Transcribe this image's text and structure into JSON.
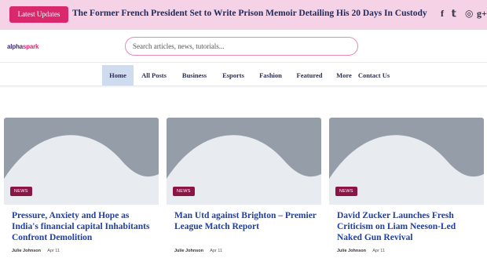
{
  "topbar": {
    "latest_label": "Latest Updates",
    "headline": "The Former French President Set to Write Prison Memoir Detailing His 20 Days In Custody",
    "social": [
      {
        "icon": "facebook-icon",
        "glyph": "f"
      },
      {
        "icon": "twitter-icon",
        "glyph": "𝕥"
      },
      {
        "icon": "instagram-icon",
        "glyph": "◎"
      },
      {
        "icon": "google-plus-icon",
        "glyph": "g+"
      }
    ]
  },
  "header": {
    "logo_part1": "alpha",
    "logo_part2": "spark",
    "search_placeholder": "Search articles, news, tutorials..."
  },
  "nav": {
    "items": [
      "Home",
      "All Posts",
      "Business",
      "Esports",
      "Fashion",
      "Featured",
      "More",
      "Contact Us"
    ],
    "active": "Home"
  },
  "cards": [
    {
      "badge": "NEWS",
      "title": "Pressure, Anxiety and Hope as India's financial capital Inhabitants Confront Demolition",
      "author": "Julie Johnson",
      "date": "Apr 11"
    },
    {
      "badge": "NEWS",
      "title": "Man Utd against Brighton – Premier League Match Report",
      "author": "Julie Johnson",
      "date": "Apr 11"
    },
    {
      "badge": "NEWS",
      "title": "David Zucker Launches Fresh Criticism on Liam Neeson-Led Naked Gun Revival",
      "author": "Julie Johnson",
      "date": "Apr 11"
    }
  ],
  "colors": {
    "topbar_bg": "#f5d2e5",
    "accent": "#d9296c",
    "title_link": "#1f3fa0",
    "placeholder_bg": "#949da8",
    "badge_bg": "#8a1546"
  }
}
